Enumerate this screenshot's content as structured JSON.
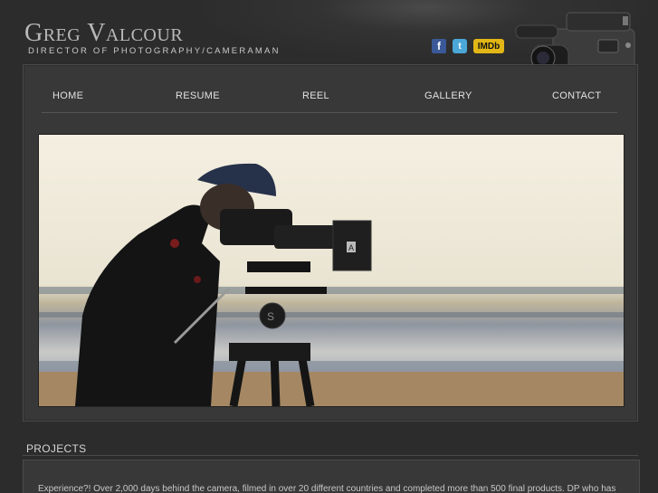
{
  "header": {
    "name": "Greg Valcour",
    "subtitle": "DIRECTOR OF PHOTOGRAPHY/CAMERAMAN",
    "social": {
      "facebook_glyph": "f",
      "twitter_glyph": "t",
      "imdb_label": "IMDb"
    }
  },
  "nav": {
    "items": [
      "HOME",
      "RESUME",
      "REEL",
      "GALLERY",
      "CONTACT"
    ]
  },
  "hero": {
    "icon": "cameraman-on-beach-photo",
    "tripod_brand": "S"
  },
  "projects": {
    "heading": "PROJECTS",
    "text": "Experience?! Over 2,000 days behind the camera, filmed in over 20 different countries and completed more than 500 final products. DP who has"
  },
  "colors": {
    "background": "#2b2b2b",
    "panel": "#383838",
    "text": "#c8c8c8",
    "imdb": "#e2b616",
    "facebook": "#3b5998",
    "twitter": "#4ba7d8"
  }
}
